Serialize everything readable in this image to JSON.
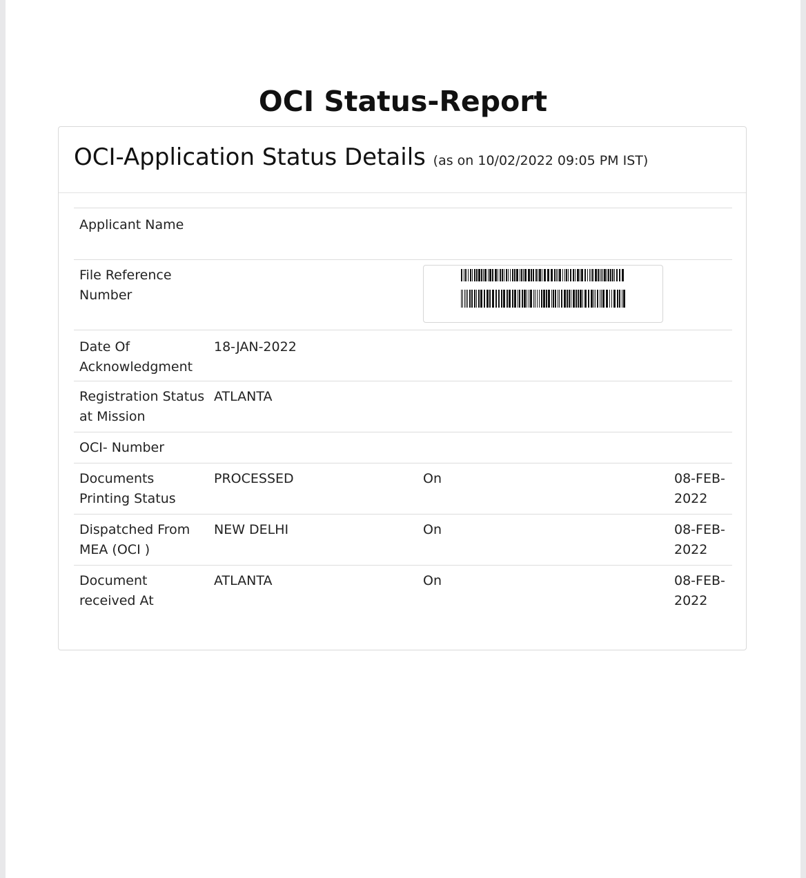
{
  "page": {
    "title": "OCI Status-Report"
  },
  "card": {
    "title": "OCI-Application Status Details",
    "subtitle": "(as on 10/02/2022 09:05 PM IST)"
  },
  "rows": [
    {
      "label": "Applicant Name",
      "value": "",
      "on": "",
      "date": ""
    },
    {
      "label": "File Reference Number",
      "value": "",
      "on": "",
      "date": ""
    },
    {
      "label": "Date Of Acknowledgment",
      "value": "18-JAN-2022",
      "on": "",
      "date": ""
    },
    {
      "label": "Registration Status at Mission",
      "value": "ATLANTA",
      "on": "",
      "date": ""
    },
    {
      "label": "OCI- Number",
      "value": "",
      "on": "",
      "date": ""
    },
    {
      "label": "Documents Printing Status",
      "value": "PROCESSED",
      "on": "On",
      "date": "08-FEB-2022"
    },
    {
      "label": "Dispatched From MEA (OCI )",
      "value": "NEW DELHI",
      "on": "On",
      "date": "08-FEB-2022"
    },
    {
      "label": "Document received At",
      "value": "ATLANTA",
      "on": "On",
      "date": "08-FEB-2022"
    }
  ]
}
